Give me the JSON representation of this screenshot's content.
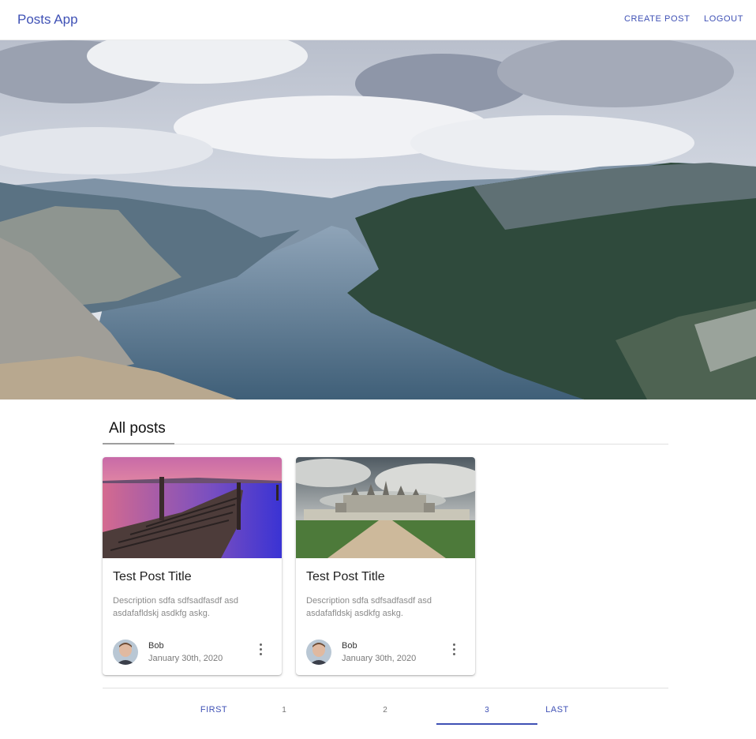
{
  "header": {
    "brand": "Posts App",
    "create_label": "CREATE POST",
    "logout_label": "LOGOUT"
  },
  "section": {
    "title": "All posts"
  },
  "posts": [
    {
      "title": "Test Post Title",
      "description": "Description sdfa sdfsadfasdf asd asdafafldskj asdkfg askg.",
      "author": "Bob",
      "date": "January 30th, 2020"
    },
    {
      "title": "Test Post Title",
      "description": "Description sdfa sdfsadfasdf asd asdafafldskj asdkfg askg.",
      "author": "Bob",
      "date": "January 30th, 2020"
    }
  ],
  "pagination": {
    "first_label": "FIRST",
    "pages": [
      "1",
      "2",
      "3"
    ],
    "active_page": "3",
    "last_label": "LAST"
  },
  "colors": {
    "primary": "#3f51b5"
  }
}
